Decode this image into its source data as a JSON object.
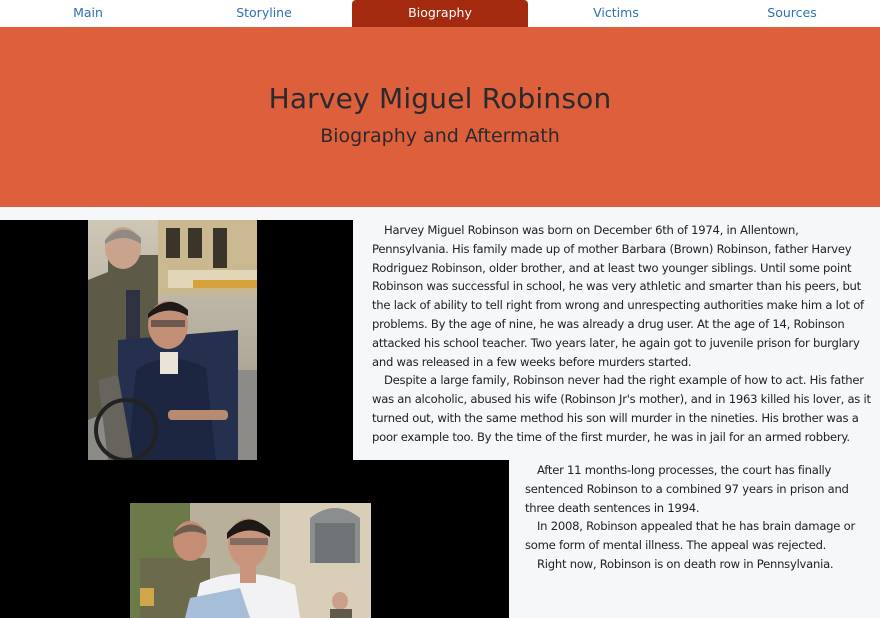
{
  "nav": {
    "items": [
      {
        "label": "Main",
        "active": false
      },
      {
        "label": "Storyline",
        "active": false
      },
      {
        "label": "Biography",
        "active": true
      },
      {
        "label": "Victims",
        "active": false
      },
      {
        "label": "Sources",
        "active": false
      }
    ]
  },
  "header": {
    "title": "Harvey Miguel Robinson",
    "subtitle": "Biography and Aftermath"
  },
  "colors": {
    "nav_active": "#a32a0e",
    "header_bg": "#de5f3b",
    "link": "#2f6fb2"
  },
  "bio": {
    "paragraphs": [
      "Harvey Miguel Robinson was born on December 6th of 1974, in Allentown, Pennsylvania. His family made up of mother Barbara (Brown) Robinson, father Harvey Rodriguez Robinson, older brother, and at least two younger siblings. Until some point Robinson was successful in school, he was very athletic and smarter than his peers, but the lack of ability to tell right from wrong and unrespecting authorities make him a lot of problems. By the age of nine, he was already a drug user. At the age of 14, Robinson attacked his school teacher. Two years later, he again got to juvenile prison for burglary and was released in a few weeks before murders started.",
      "Despite a large family, Robinson never had the right example of how to act. His father was an alcoholic, abused his wife (Robinson Jr's mother), and in 1963 killed his lover, as it turned out, with the same method his son will murder in the nineties. His brother was a poor example too. By the time of the first murder, he was in jail for an armed robbery."
    ]
  },
  "aftermath": {
    "paragraphs": [
      "After 11 months-long processes, the court has finally sentenced Robinson to a combined 97 years in prison and three death sentences in 1994.",
      "In 2008, Robinson appealed that he has brain damage or some form of mental illness. The appeal was rejected.",
      "Right now, Robinson is on death row in Pennsylvania."
    ]
  }
}
